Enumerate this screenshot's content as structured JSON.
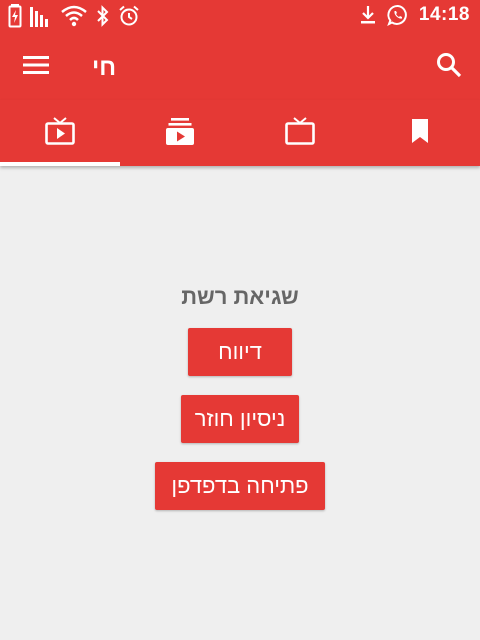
{
  "status_bar": {
    "time": "14:18",
    "left_icons": [
      "battery-charging-icon",
      "signal-icon",
      "wifi-icon",
      "bluetooth-icon",
      "alarm-icon"
    ],
    "right_icons": [
      "download-icon",
      "whatsapp-icon"
    ]
  },
  "app_bar": {
    "title": "חי",
    "menu_icon": "menu-icon",
    "search_icon": "search-icon"
  },
  "tabs": [
    {
      "icon": "live-tv-icon",
      "selected": true
    },
    {
      "icon": "subscriptions-icon",
      "selected": false
    },
    {
      "icon": "tv-icon",
      "selected": false
    },
    {
      "icon": "bookmark-icon",
      "selected": false
    }
  ],
  "error": {
    "title": "שגיאת רשת",
    "report_label": "דיווח",
    "retry_label": "ניסיון חוזר",
    "open_browser_label": "פתיחה בדפדפן"
  },
  "colors": {
    "primary": "#e53935",
    "background": "#efefef",
    "error_text": "#666666"
  }
}
